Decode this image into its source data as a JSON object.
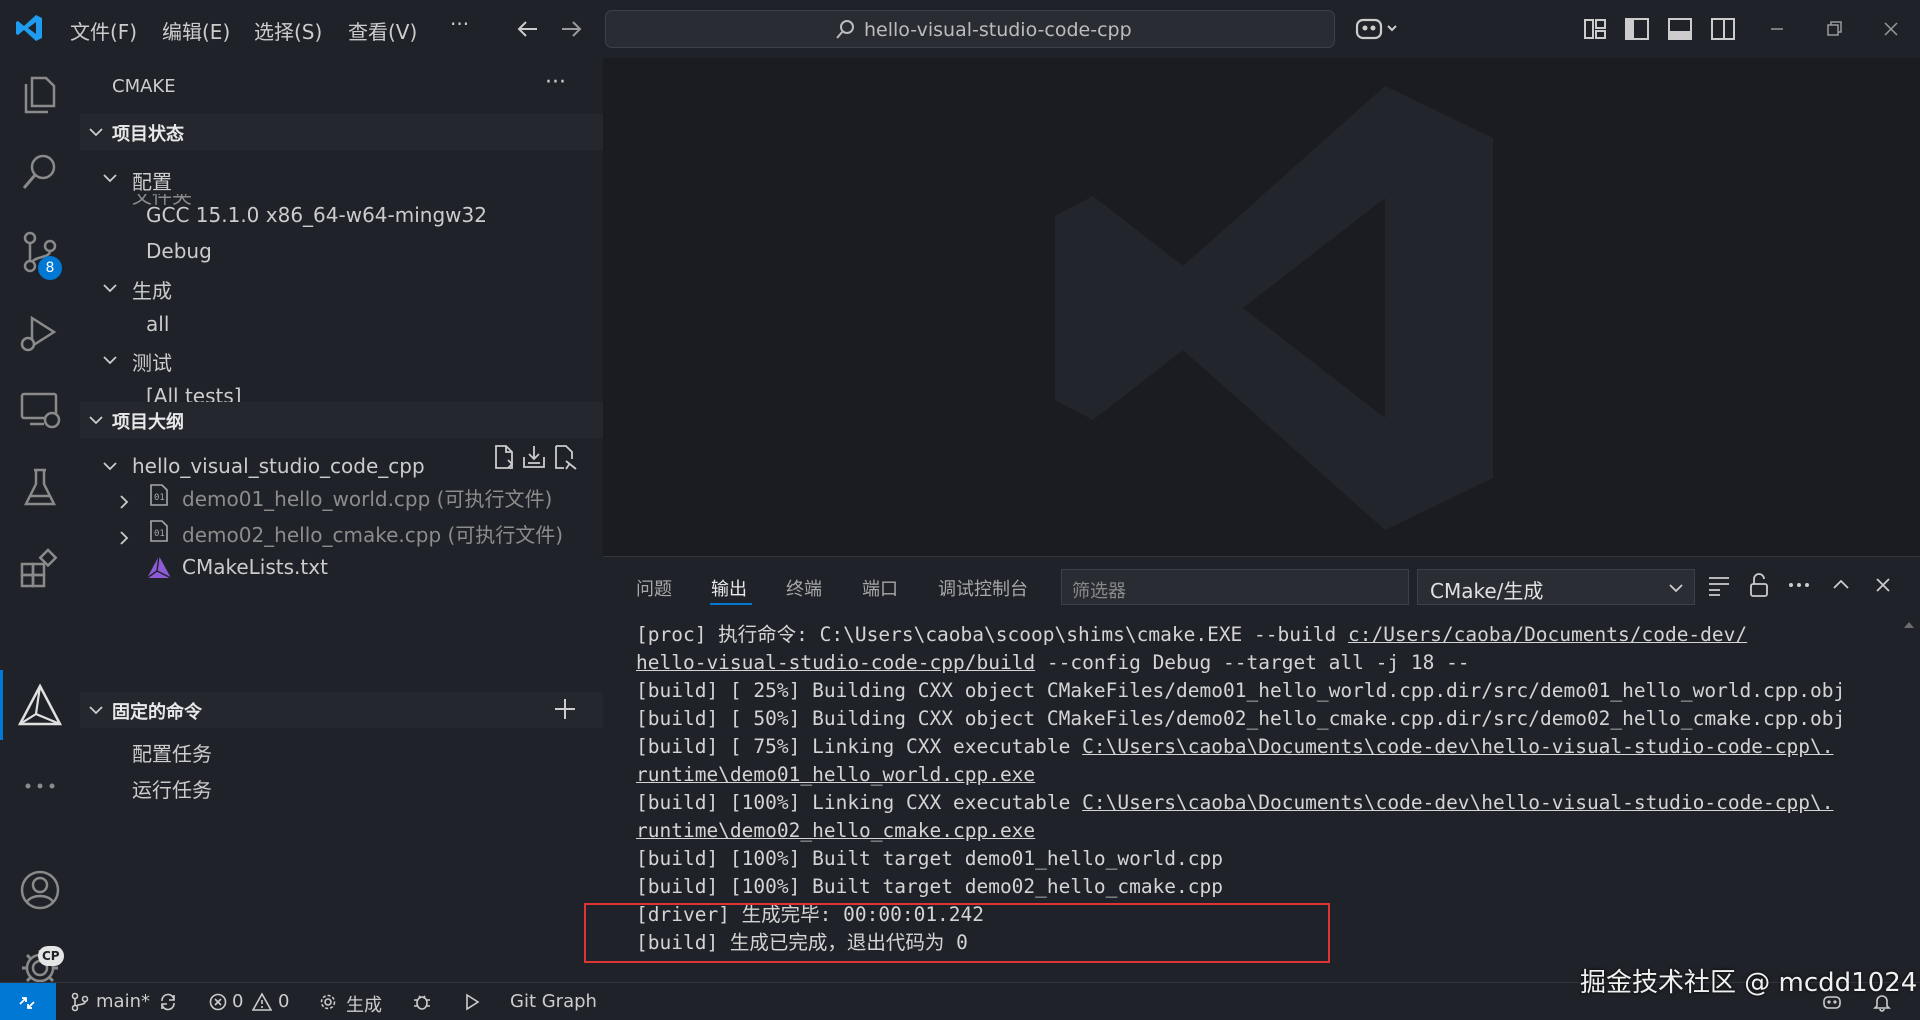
{
  "titlebar": {
    "menus": [
      "文件(F)",
      "编辑(E)",
      "选择(S)",
      "查看(V)",
      "···"
    ],
    "search_label": "hello-visual-studio-code-cpp",
    "icons": [
      "vscode-logo-icon",
      "back-arrow-icon",
      "forward-arrow-icon",
      "copilot-icon",
      "customize-layout-icon",
      "toggle-sidebar-icon",
      "toggle-panel-icon",
      "toggle-secondary-sidebar-icon",
      "minimize-icon",
      "restore-icon",
      "close-icon"
    ]
  },
  "activitybar": {
    "items": [
      "explorer-icon",
      "search-icon",
      "source-control-icon",
      "run-debug-icon",
      "remote-explorer-icon",
      "testing-icon",
      "extensions-icon",
      "cmake-icon",
      "more-icon",
      "account-icon",
      "settings-icon"
    ],
    "source_control_badge": "8",
    "settings_badge": "CP"
  },
  "sidebar": {
    "title": "CMAKE",
    "more": "···",
    "project_status": {
      "header": "项目状态",
      "clipped_text": "文件夹",
      "config_label": "配置",
      "compiler": "GCC 15.1.0 x86_64-w64-mingw32",
      "build_type": "Debug",
      "build_label": "生成",
      "build_target": "all",
      "test_label": "测试",
      "test_target": "[All tests]"
    },
    "project_outline": {
      "header": "项目大纲",
      "project": "hello_visual_studio_code_cpp",
      "items": [
        "demo01_hello_world.cpp (可执行文件)",
        "demo02_hello_cmake.cpp (可执行文件)",
        "CMakeLists.txt"
      ]
    },
    "pinned": {
      "header": "固定的命令",
      "items": [
        "配置任务",
        "运行任务"
      ]
    }
  },
  "panel": {
    "tabs": [
      "问题",
      "输出",
      "终端",
      "端口",
      "调试控制台"
    ],
    "active_tab": "输出",
    "filter_placeholder": "筛选器",
    "channel": "CMake/生成",
    "log": [
      {
        "parts": [
          {
            "t": "[proc] 执行命令: C:\\Users\\caoba\\scoop\\shims\\cmake.EXE --build "
          },
          {
            "t": "c:/Users/caoba/Documents/code-dev/",
            "u": true
          }
        ]
      },
      {
        "parts": [
          {
            "t": "hello-visual-studio-code-cpp/build",
            "u": true
          },
          {
            "t": " --config Debug --target all -j 18 --"
          }
        ]
      },
      {
        "parts": [
          {
            "t": "[build] [ 25%] Building CXX object CMakeFiles/demo01_hello_world.cpp.dir/src/demo01_hello_world.cpp.obj"
          }
        ]
      },
      {
        "parts": [
          {
            "t": "[build] [ 50%] Building CXX object CMakeFiles/demo02_hello_cmake.cpp.dir/src/demo02_hello_cmake.cpp.obj"
          }
        ]
      },
      {
        "parts": [
          {
            "t": "[build] [ 75%] Linking CXX executable "
          },
          {
            "t": "C:\\Users\\caoba\\Documents\\code-dev\\hello-visual-studio-code-cpp\\.",
            "u": true
          }
        ]
      },
      {
        "parts": [
          {
            "t": "runtime\\demo01_hello_world.cpp.exe",
            "u": true
          }
        ]
      },
      {
        "parts": [
          {
            "t": "[build] [100%] Linking CXX executable "
          },
          {
            "t": "C:\\Users\\caoba\\Documents\\code-dev\\hello-visual-studio-code-cpp\\.",
            "u": true
          }
        ]
      },
      {
        "parts": [
          {
            "t": "runtime\\demo02_hello_cmake.cpp.exe",
            "u": true
          }
        ]
      },
      {
        "parts": [
          {
            "t": "[build] [100%] Built target demo01_hello_world.cpp"
          }
        ]
      },
      {
        "parts": [
          {
            "t": "[build] [100%] Built target demo02_hello_cmake.cpp"
          }
        ]
      },
      {
        "parts": [
          {
            "t": "[driver] 生成完毕: 00:00:01.242"
          }
        ]
      },
      {
        "parts": [
          {
            "t": "[build] 生成已完成，退出代码为 0"
          }
        ]
      }
    ]
  },
  "statusbar": {
    "branch": "main*",
    "errors": "0",
    "warnings": "0",
    "build": "生成",
    "git_graph": "Git Graph"
  },
  "credit": "掘金技术社区 @ mcdd1024",
  "colors": {
    "accent": "#0078d4",
    "highlight_box": "#e03434",
    "background": "#1f2228",
    "editor_background": "#1a1c21"
  }
}
